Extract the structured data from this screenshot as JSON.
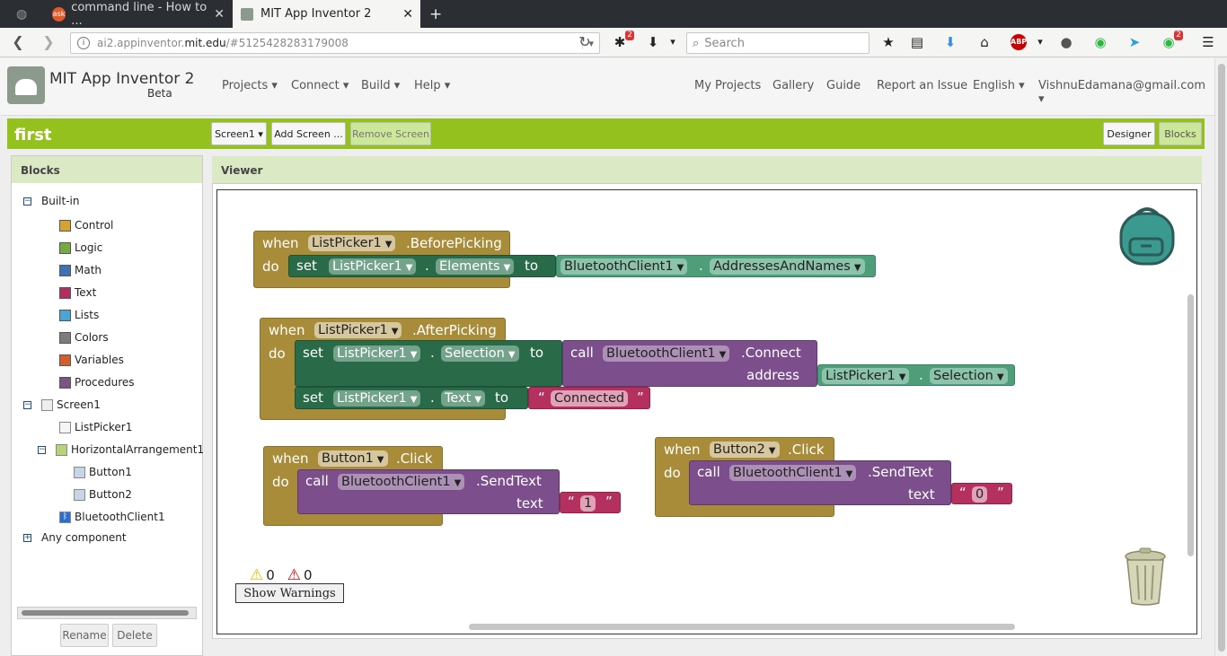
{
  "browser": {
    "tabs": [
      {
        "title": "command line - How to ..."
      },
      {
        "title": "MIT App Inventor 2"
      }
    ],
    "url_prefix": "ai2.appinventor.",
    "url_domain": "mit.edu",
    "url_suffix": "/#5125428283179008",
    "search_placeholder": "Search",
    "ext_badge_1": "2",
    "ext_badge_2": "2"
  },
  "app": {
    "title": "MIT App Inventor 2",
    "subtitle": "Beta",
    "menus": [
      "Projects ▾",
      "Connect ▾",
      "Build ▾",
      "Help ▾"
    ],
    "right_menus": [
      "My Projects",
      "Gallery",
      "Guide",
      "Report an Issue",
      "English ▾",
      "VishnuEdamana@gmail.com ▾"
    ]
  },
  "project": {
    "name": "first",
    "screen_select": "Screen1 ▾",
    "add_screen": "Add Screen ...",
    "remove_screen": "Remove Screen",
    "designer": "Designer",
    "blocks": "Blocks"
  },
  "blocks_panel": {
    "header": "Blocks",
    "builtin": "Built-in",
    "categories": [
      {
        "label": "Control",
        "color": "#d6a333"
      },
      {
        "label": "Logic",
        "color": "#77ab41"
      },
      {
        "label": "Math",
        "color": "#3f71b5"
      },
      {
        "label": "Text",
        "color": "#b32d5e"
      },
      {
        "label": "Lists",
        "color": "#49a6d4"
      },
      {
        "label": "Colors",
        "color": "#7d7d7d"
      },
      {
        "label": "Variables",
        "color": "#d05f2d"
      },
      {
        "label": "Procedures",
        "color": "#7c5385"
      }
    ],
    "screen1": "Screen1",
    "listpicker": "ListPicker1",
    "harrangement": "HorizontalArrangement1",
    "button1": "Button1",
    "button2": "Button2",
    "bluetooth": "BluetoothClient1",
    "any_component": "Any component",
    "rename": "Rename",
    "delete": "Delete"
  },
  "viewer": {
    "header": "Viewer",
    "warn_count": "0",
    "error_count": "0",
    "show_warnings": "Show Warnings"
  },
  "code": {
    "when": "when",
    "do": "do",
    "set": "set",
    "to": "to",
    "call": "call",
    "dot": ".",
    "lp1": "ListPicker1",
    "before": ".BeforePicking",
    "after": ".AfterPicking",
    "elements": "Elements",
    "selection": "Selection",
    "text_prop": "Text",
    "bt": "BluetoothClient1",
    "addr_names": "AddressesAndNames",
    "connect": ".Connect",
    "address": "address",
    "connected": "Connected",
    "btn1": "Button1",
    "btn2": "Button2",
    "click": ".Click",
    "sendtext": ".SendText",
    "text_arg": "text",
    "one": "1",
    "zero": "0"
  }
}
